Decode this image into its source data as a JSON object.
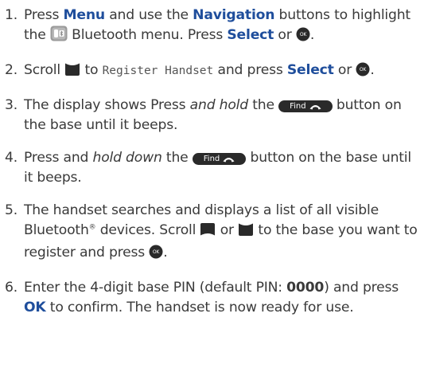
{
  "steps": [
    {
      "number": "1.",
      "t1": "Press ",
      "menu": "Menu",
      "t2": " and use the ",
      "navigation": "Navigation",
      "t3": " buttons to highlight the ",
      "t4": " Bluetooth menu. Press ",
      "select": "Select",
      "t5": " or "
    },
    {
      "number": "2.",
      "t1": "Scroll ",
      "t2": " to ",
      "display": "Register Handset",
      "t3": " and press ",
      "select": "Select",
      "t4": " or "
    },
    {
      "number": "3.",
      "t1": "The display shows Press ",
      "emph": "and hold",
      "t2": " the ",
      "t3": " button on the base until it beeps."
    },
    {
      "number": "4.",
      "t1": "Press and ",
      "emph": "hold down",
      "t2": " the ",
      "t3": " button on the base until it beeps."
    },
    {
      "number": "5.",
      "t1": "The handset searches and displays a list of all visible Bluetooth",
      "reg": "®",
      "t2": " devices. Scroll ",
      "t3": " or ",
      "t4": " to the base you want to register and press ",
      "t5": "."
    },
    {
      "number": "6.",
      "t1": "Enter the 4-digit base PIN (default PIN: ",
      "pin": "0000",
      "t2": ") and press ",
      "ok": "OK",
      "t3": " to confirm. The handset is now ready for use."
    }
  ],
  "find_button": {
    "label": "Find"
  },
  "ok_key": {
    "label": "OK"
  },
  "icons": {
    "bluetooth_menu": "bluetooth-menu-icon",
    "scroll_down": "scroll-down-icon",
    "scroll_up": "scroll-up-icon",
    "ok_button": "ok-button-icon",
    "find_button": "find-button-icon"
  },
  "colors": {
    "text": "#3a3a3a",
    "keyword": "#1f4e9c",
    "button": "#2a2a2a"
  }
}
